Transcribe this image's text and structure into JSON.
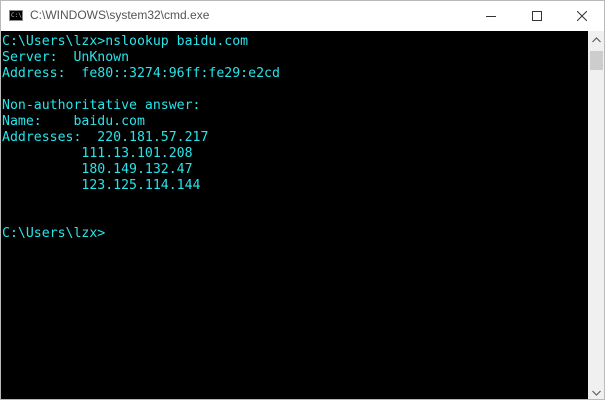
{
  "window": {
    "title": "C:\\WINDOWS\\system32\\cmd.exe",
    "icon": "cmd-icon",
    "icon_glyph": "C:\\"
  },
  "caption_buttons": {
    "minimize": "minimize-icon",
    "maximize": "maximize-icon",
    "close": "close-icon"
  },
  "console": {
    "text_color": "#28e4ea",
    "background": "#000000",
    "lines": [
      "C:\\Users\\lzx>nslookup baidu.com",
      "Server:  UnKnown",
      "Address:  fe80::3274:96ff:fe29:e2cd",
      "",
      "Non-authoritative answer:",
      "Name:    baidu.com",
      "Addresses:  220.181.57.217",
      "          111.13.101.208",
      "          180.149.132.47",
      "          123.125.114.144",
      "",
      "",
      "C:\\Users\\lzx>"
    ]
  },
  "scrollbar": {
    "up": "scroll-up-arrow-icon",
    "down": "scroll-down-arrow-icon",
    "position": 0
  }
}
